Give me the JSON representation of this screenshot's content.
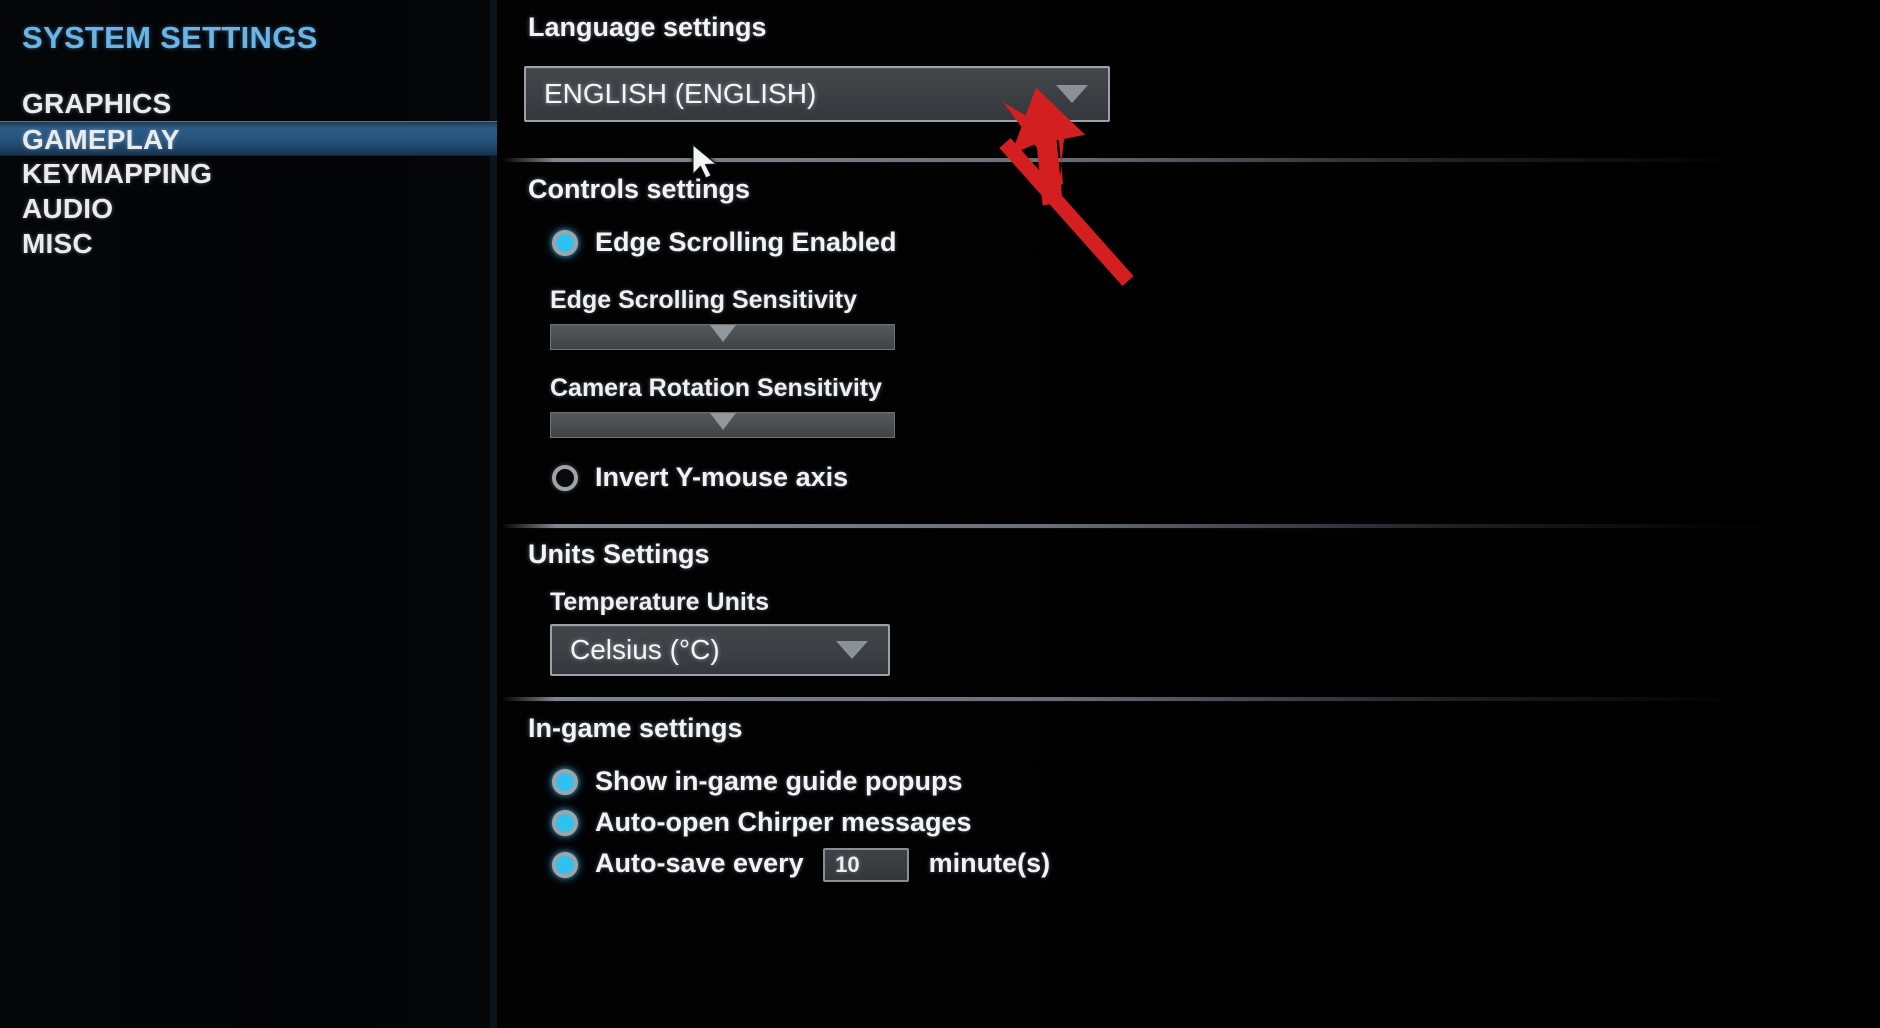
{
  "sidebar": {
    "title": "SYSTEM SETTINGS",
    "items": [
      {
        "label": "GRAPHICS",
        "selected": false
      },
      {
        "label": "GAMEPLAY",
        "selected": true
      },
      {
        "label": "KEYMAPPING",
        "selected": false
      },
      {
        "label": "AUDIO",
        "selected": false
      },
      {
        "label": "MISC",
        "selected": false
      }
    ]
  },
  "sections": {
    "language": {
      "heading": "Language settings",
      "dropdown_value": "ENGLISH (ENGLISH)",
      "dropdown_icon": "chevron-down-icon"
    },
    "controls": {
      "heading": "Controls settings",
      "edge_scrolling_enabled": "Edge Scrolling Enabled",
      "edge_scrolling_sensitivity": "Edge Scrolling Sensitivity",
      "camera_rotation_sensitivity": "Camera Rotation Sensitivity",
      "invert_y_mouse_axis": "Invert Y-mouse axis"
    },
    "units": {
      "heading": "Units Settings",
      "temperature_label": "Temperature Units",
      "temperature_value": "Celsius (°C)",
      "dropdown_icon": "chevron-down-icon"
    },
    "ingame": {
      "heading": "In-game settings",
      "show_guide_popups": "Show in-game guide popups",
      "auto_open_chirper": "Auto-open Chirper messages",
      "autosave_prefix": "Auto-save every",
      "autosave_value": "10",
      "autosave_suffix": "minute(s)"
    }
  },
  "colors": {
    "accent_blue": "#6cb4e4",
    "radio_on": "#2fc1ef",
    "selected_nav": "#2b5c88",
    "annotation_red": "#d31f1f",
    "dropdown_fill": "#3c4044",
    "slider_track": "#4c5053"
  },
  "annotation": {
    "arrow_name": "red-pointer-arrow",
    "points_to": "ENGLISH (ENGLISH)"
  },
  "cursor": {
    "name": "mouse-cursor"
  }
}
